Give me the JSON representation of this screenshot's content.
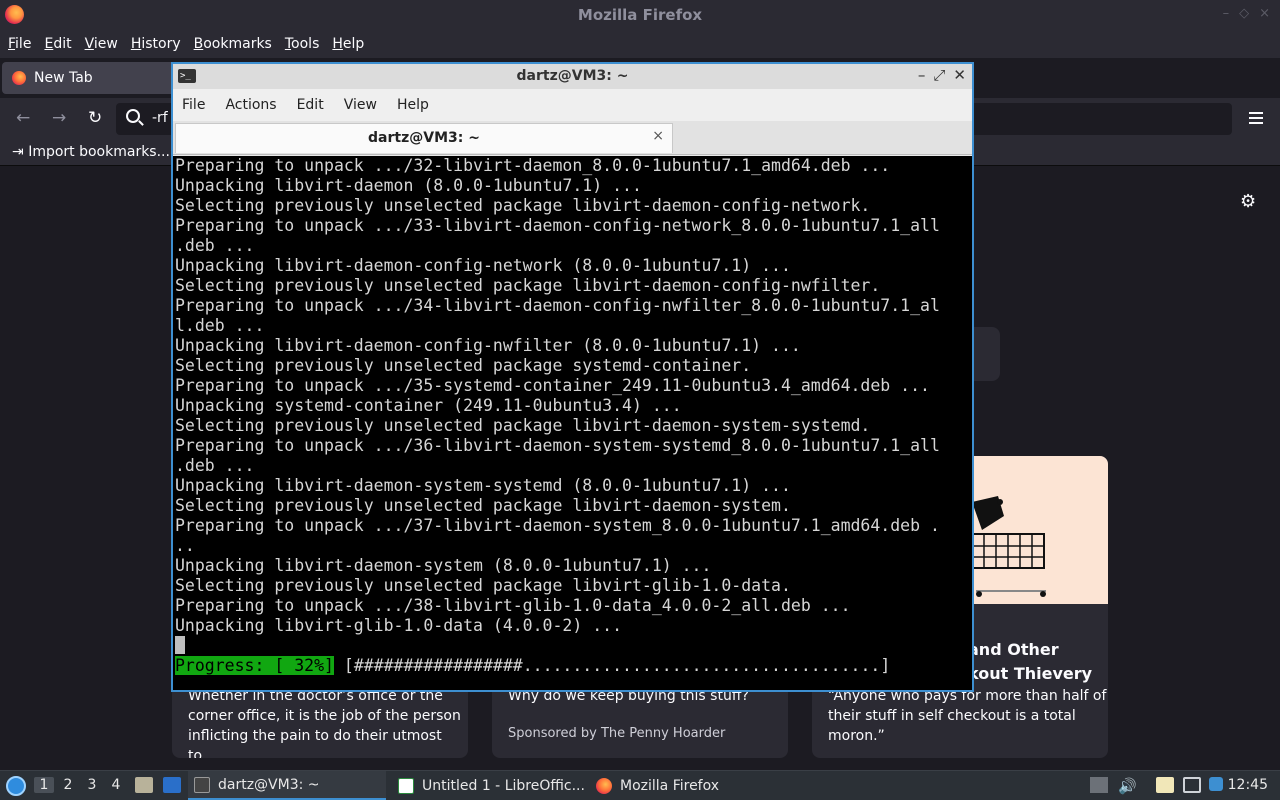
{
  "firefox": {
    "window_title": "Mozilla Firefox",
    "menu": [
      "File",
      "Edit",
      "View",
      "History",
      "Bookmarks",
      "Tools",
      "Help"
    ],
    "tab_label": "New Tab",
    "url_text": "-rf",
    "bookmark_item": "Import bookmarks...",
    "cards": [
      {
        "headline_1": "and Other",
        "headline_2": "kout Thievery",
        "excerpt_1": "“Anyone who pays for more than half of",
        "excerpt_2": "their stuff in self checkout is a total",
        "excerpt_3": "moron.”"
      },
      {
        "excerpt_1": "Why do we keep buying this stuff?",
        "sponsor": "Sponsored by The Penny Hoarder"
      },
      {
        "excerpt_1": "Whether in the doctor’s office or the",
        "excerpt_2": "corner office, it is the job of the person",
        "excerpt_3": "inflicting the pain to do their utmost to…"
      }
    ],
    "icons": {
      "back": "arrow-left-icon",
      "forward": "arrow-right-icon",
      "reload": "reload-icon",
      "search": "search-icon",
      "menu": "hamburger-menu-icon",
      "settings": "gear-icon"
    }
  },
  "terminal": {
    "window_title": "dartz@VM3: ~",
    "menu": [
      "File",
      "Actions",
      "Edit",
      "View",
      "Help"
    ],
    "tab_title": "dartz@VM3: ~",
    "close_tab": "×",
    "lines": [
      "Preparing to unpack .../32-libvirt-daemon_8.0.0-1ubuntu7.1_amd64.deb ...",
      "Unpacking libvirt-daemon (8.0.0-1ubuntu7.1) ...",
      "Selecting previously unselected package libvirt-daemon-config-network.",
      "Preparing to unpack .../33-libvirt-daemon-config-network_8.0.0-1ubuntu7.1_all",
      ".deb ...",
      "Unpacking libvirt-daemon-config-network (8.0.0-1ubuntu7.1) ...",
      "Selecting previously unselected package libvirt-daemon-config-nwfilter.",
      "Preparing to unpack .../34-libvirt-daemon-config-nwfilter_8.0.0-1ubuntu7.1_al",
      "l.deb ...",
      "Unpacking libvirt-daemon-config-nwfilter (8.0.0-1ubuntu7.1) ...",
      "Selecting previously unselected package systemd-container.",
      "Preparing to unpack .../35-systemd-container_249.11-0ubuntu3.4_amd64.deb ...",
      "Unpacking systemd-container (249.11-0ubuntu3.4) ...",
      "Selecting previously unselected package libvirt-daemon-system-systemd.",
      "Preparing to unpack .../36-libvirt-daemon-system-systemd_8.0.0-1ubuntu7.1_all",
      ".deb ...",
      "Unpacking libvirt-daemon-system-systemd (8.0.0-1ubuntu7.1) ...",
      "Selecting previously unselected package libvirt-daemon-system.",
      "Preparing to unpack .../37-libvirt-daemon-system_8.0.0-1ubuntu7.1_amd64.deb .",
      "..",
      "Unpacking libvirt-daemon-system (8.0.0-1ubuntu7.1) ...",
      "Selecting previously unselected package libvirt-glib-1.0-data.",
      "Preparing to unpack .../38-libvirt-glib-1.0-data_4.0.0-2_all.deb ...",
      "Unpacking libvirt-glib-1.0-data (4.0.0-2) ..."
    ],
    "progress_label": "Progress: [ 32%]",
    "progress_bar": " [#################....................................]",
    "progress_percent": 32
  },
  "taskbar": {
    "workspaces": [
      "1",
      "2",
      "3",
      "4"
    ],
    "tasks": [
      {
        "label": "dartz@VM3: ~",
        "icon": "terminal-icon"
      },
      {
        "label": "Untitled 1 - LibreOffic...",
        "icon": "libreoffice-writer-icon"
      },
      {
        "label": "Mozilla Firefox",
        "icon": "firefox-icon"
      }
    ],
    "clock": "12:45"
  }
}
